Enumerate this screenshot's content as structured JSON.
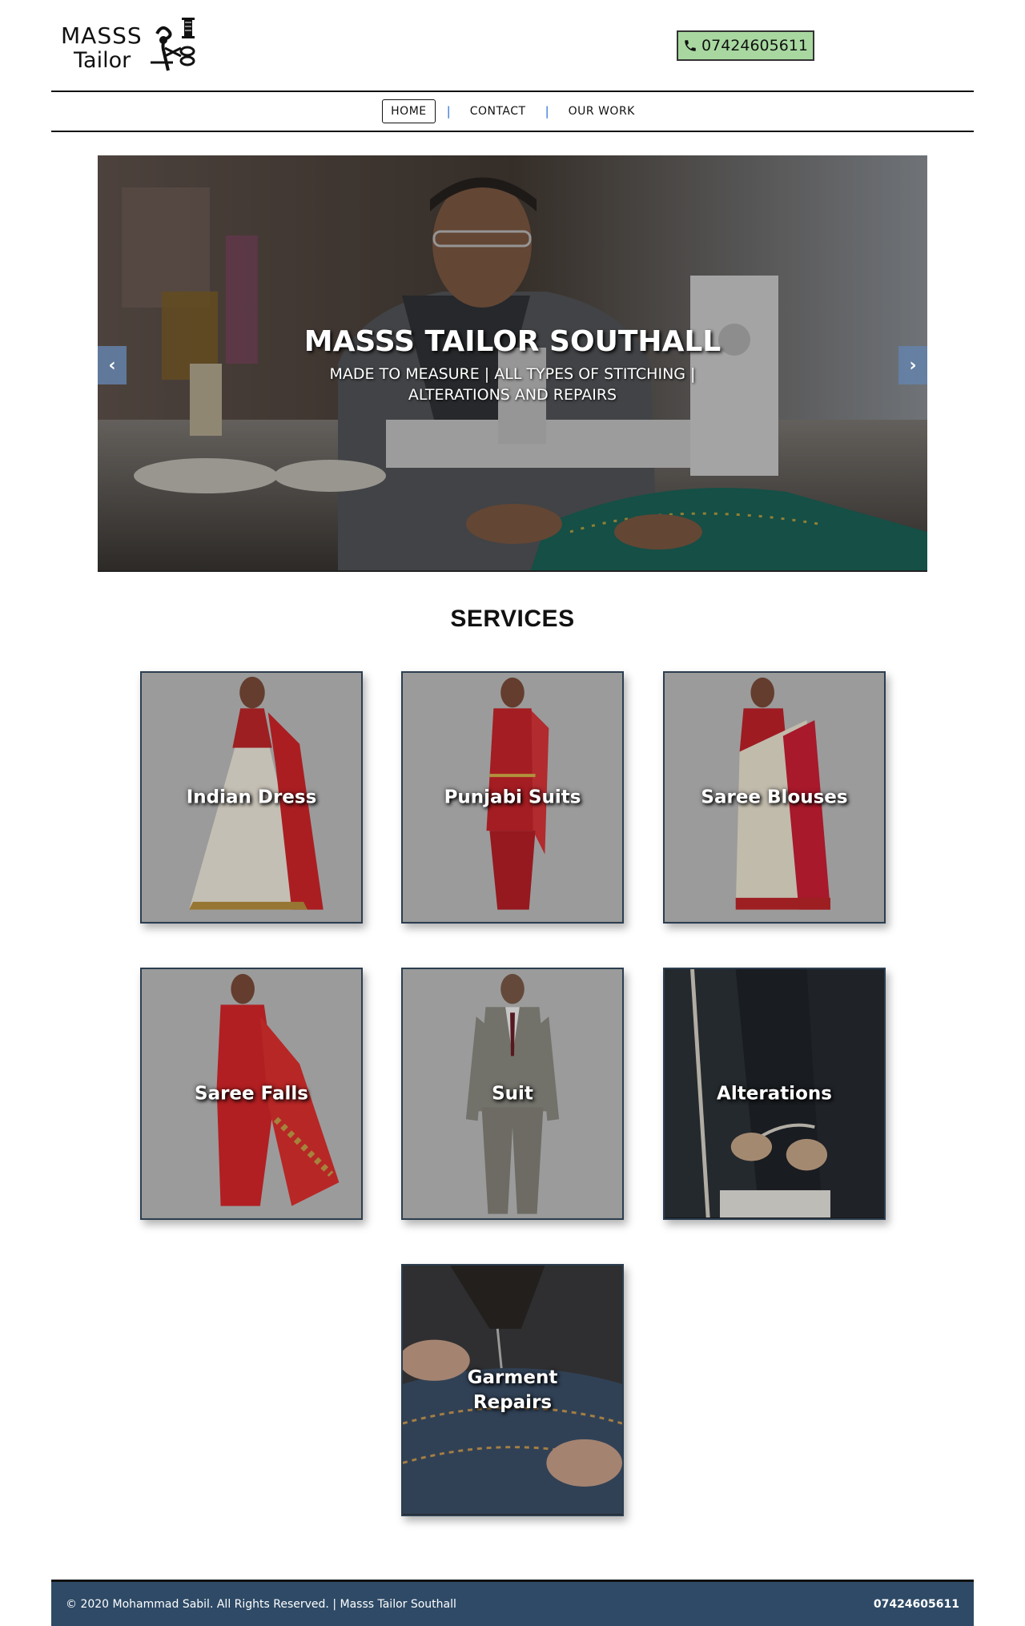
{
  "brand": {
    "line1": "MASSS",
    "line2": "Tailor"
  },
  "header": {
    "phone": "07424605611"
  },
  "nav": {
    "items": [
      {
        "label": "HOME"
      },
      {
        "label": "CONTACT"
      },
      {
        "label": "OUR WORK"
      }
    ],
    "separator": "|"
  },
  "hero": {
    "title": "MASSS TAILOR SOUTHALL",
    "subtitle": "MADE TO MEASURE | ALL TYPES OF STITCHING | ALTERATIONS AND REPAIRS",
    "prev": "‹",
    "next": "›"
  },
  "services": {
    "title": "SERVICES",
    "items": [
      {
        "label": "Indian Dress"
      },
      {
        "label": "Punjabi Suits"
      },
      {
        "label": "Saree Blouses"
      },
      {
        "label": "Saree Falls"
      },
      {
        "label": "Suit"
      },
      {
        "label": "Alterations"
      },
      {
        "label": "Garment Repairs"
      }
    ]
  },
  "footer": {
    "copyright": "© 2020 Mohammad Sabil. All Rights Reserved. | Masss Tailor Southall",
    "phone": "07424605611"
  },
  "colors": {
    "phone_bg": "#a8d8a0",
    "footer_bg": "#2e4a66",
    "card_border": "#2c3e50",
    "nav_separator": "#2a6fd6"
  }
}
